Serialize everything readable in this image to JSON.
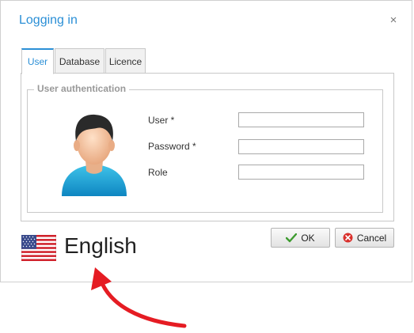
{
  "dialog": {
    "title": "Logging in",
    "close_glyph": "×"
  },
  "tabs": [
    {
      "label": "User",
      "active": true
    },
    {
      "label": "Database",
      "active": false
    },
    {
      "label": "Licence",
      "active": false
    }
  ],
  "auth": {
    "group_title": "User authentication",
    "avatar_icon": "user-avatar-icon",
    "fields": [
      {
        "label": "User *",
        "value": ""
      },
      {
        "label": "Password *",
        "value": ""
      },
      {
        "label": "Role",
        "value": ""
      }
    ]
  },
  "buttons": {
    "ok_label": "OK",
    "ok_icon": "checkmark-icon",
    "cancel_label": "Cancel",
    "cancel_icon": "cancel-icon"
  },
  "language": {
    "label": "English",
    "flag_icon": "us-flag-icon"
  },
  "annotation": {
    "arrow_icon": "red-curved-arrow-icon",
    "arrow_color": "#e51c23"
  },
  "colors": {
    "accent": "#2b8fd6",
    "ok_check": "#3d9b2f",
    "cancel_red": "#d9302c"
  }
}
